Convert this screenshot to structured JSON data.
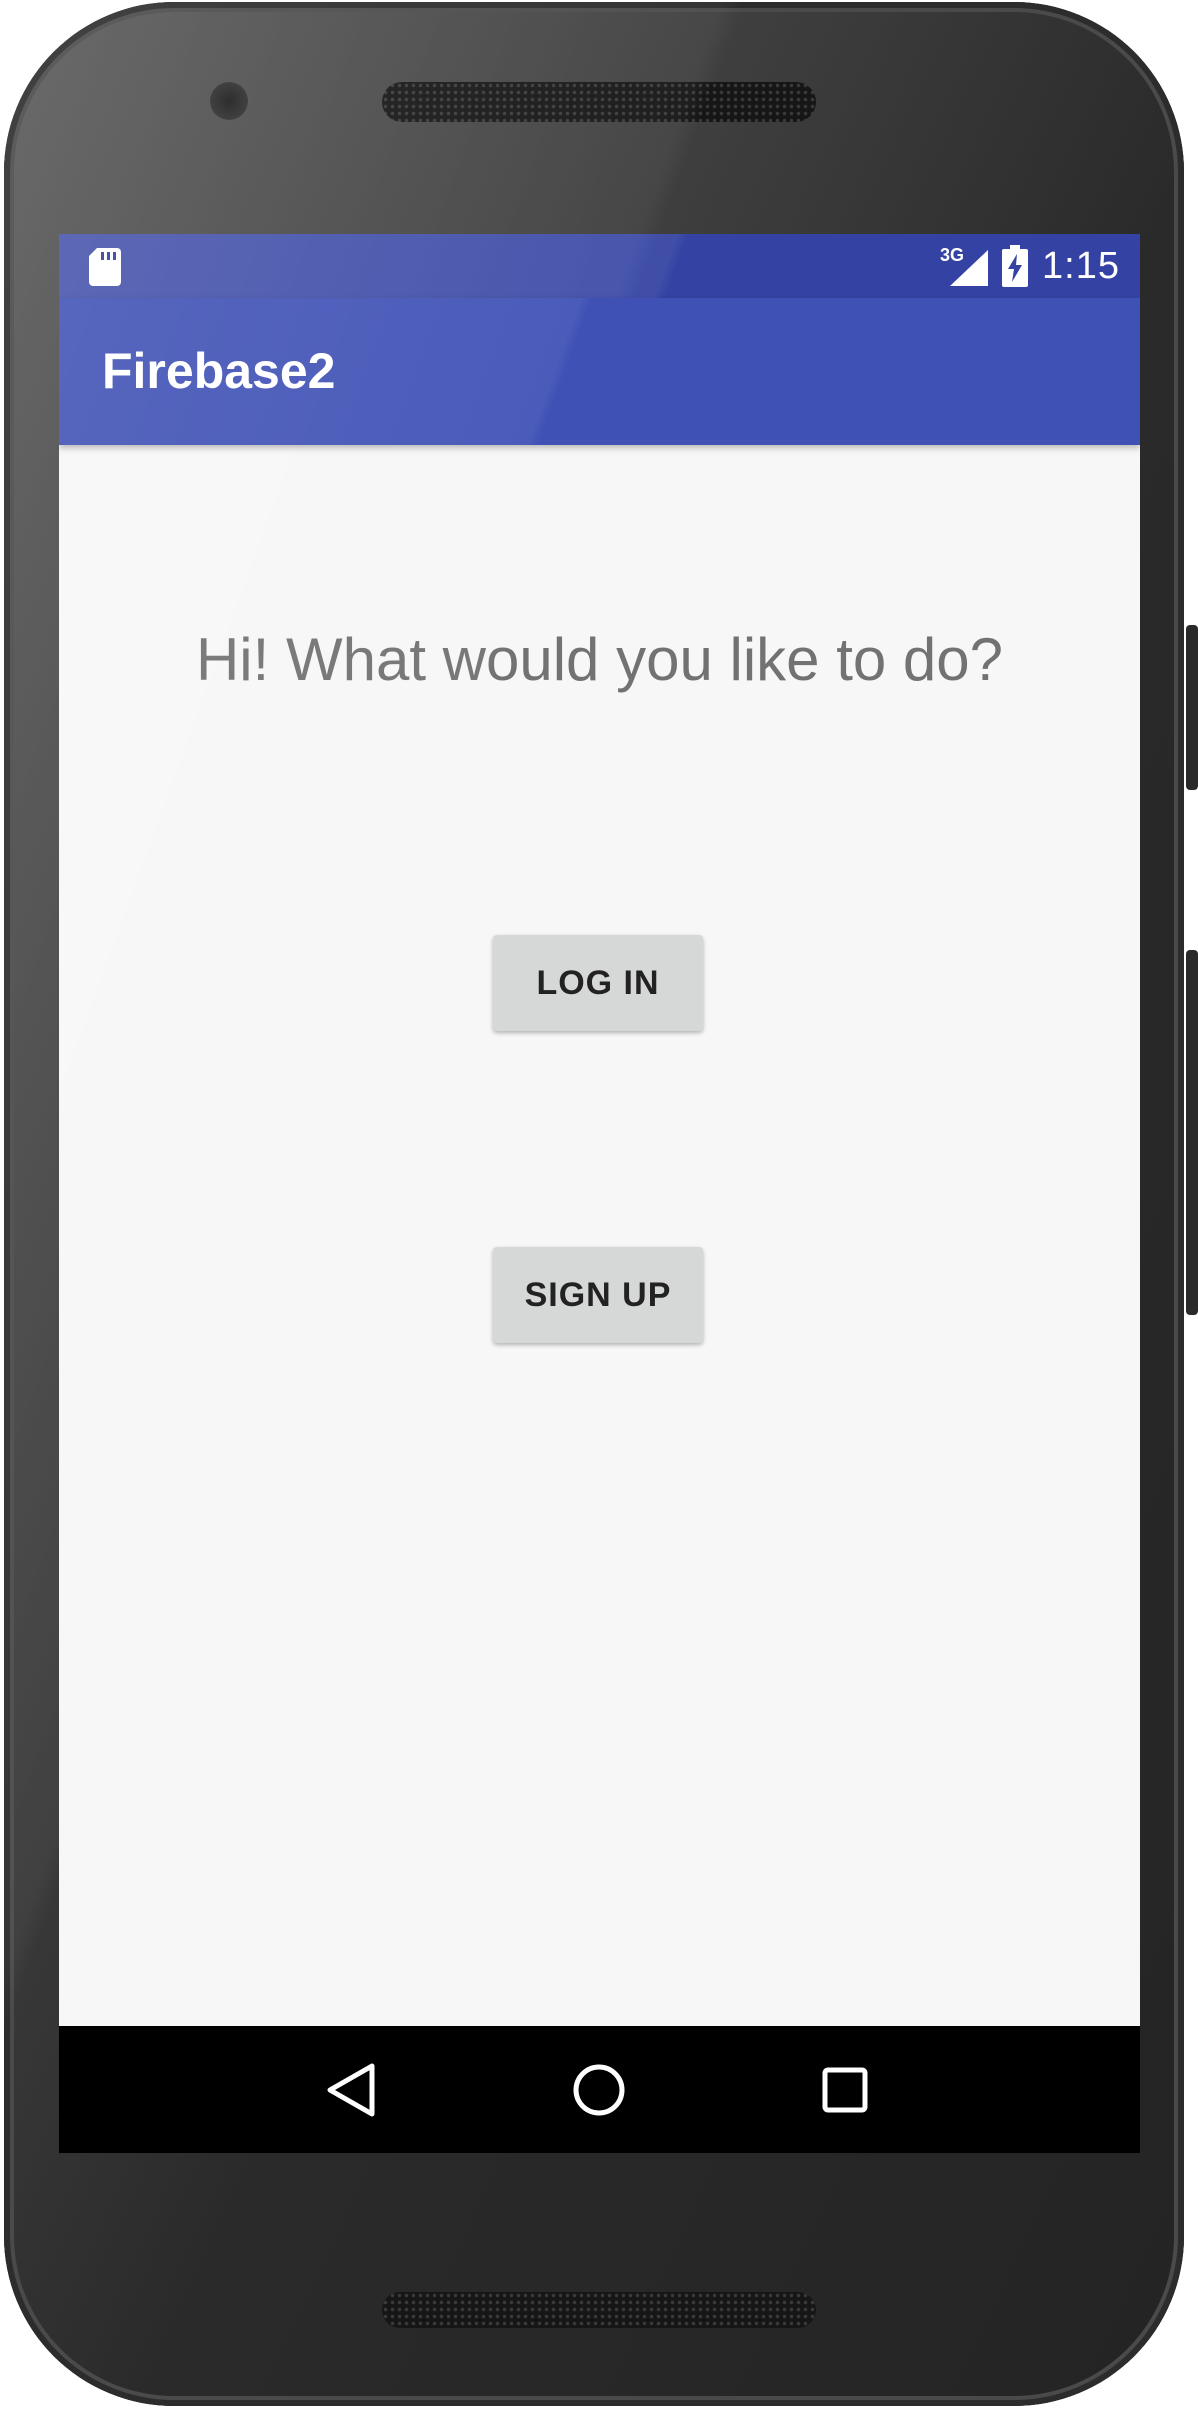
{
  "status_bar": {
    "network_type": "3G",
    "time": "1:15"
  },
  "app_bar": {
    "title": "Firebase2"
  },
  "main": {
    "greeting": "Hi! What would you like to do?",
    "login_label": "LOG IN",
    "signup_label": "SIGN UP"
  },
  "navigation": {
    "back_icon": "back-triangle-icon",
    "home_icon": "home-circle-icon",
    "recents_icon": "recents-square-icon"
  },
  "colors": {
    "status_bar": "#3443a3",
    "app_bar": "#3f51b5",
    "background": "#f7f7f7",
    "button": "#d6d7d7",
    "greeting_text": "#727272",
    "nav_bar": "#000000"
  }
}
